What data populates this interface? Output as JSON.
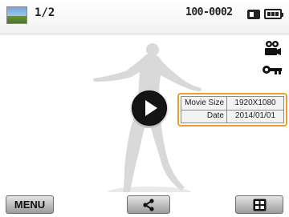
{
  "status_bar": {
    "image_counter": "1/2",
    "file_number": "100-0002",
    "thumbnail_icon": "landscape-thumbnail-icon",
    "memory_icon": "memory-card-icon",
    "battery_icon": "battery-full-icon"
  },
  "side_icons": {
    "movie": "movie-camera-icon",
    "protect": "key-icon"
  },
  "info": {
    "rows": [
      {
        "label": "Movie Size",
        "value": "1920X1080"
      },
      {
        "label": "Date",
        "value": "2014/01/01"
      }
    ]
  },
  "bottom_bar": {
    "menu_label": "MENU",
    "share_icon": "share-icon",
    "view_icon": "thumbnail-view-icon"
  },
  "colors": {
    "accent": "#e8a02e",
    "button_dark": "#141414"
  }
}
